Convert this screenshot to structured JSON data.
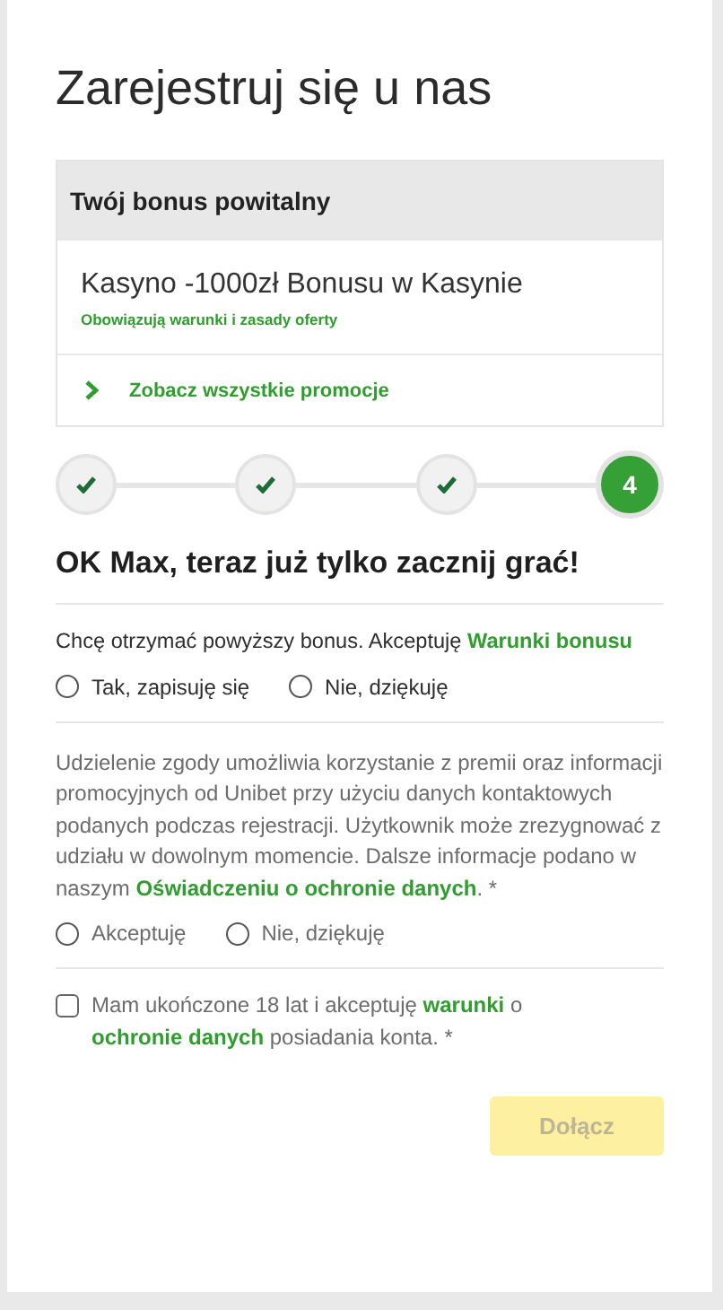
{
  "title": "Zarejestruj się u nas",
  "bonus": {
    "header": "Twój bonus powitalny",
    "name": "Kasyno -1000zł Bonusu w Kasynie",
    "terms": "Obowiązują warunki i zasady oferty",
    "link": "Zobacz wszystkie promocje"
  },
  "steps": [
    {
      "kind": "done"
    },
    {
      "kind": "done"
    },
    {
      "kind": "done"
    },
    {
      "kind": "current",
      "label": "4"
    }
  ],
  "heading": "OK Max, teraz już tylko zacznij grać!",
  "bonus_consent": {
    "text": [
      {
        "kind": "text",
        "text": "Chcę otrzymać powyższy bonus. Akceptuję "
      },
      {
        "kind": "link",
        "text": "Warunki bonusu"
      }
    ],
    "options": [
      {
        "label": "Tak, zapisuję się",
        "selected": false
      },
      {
        "label": "Nie, dziękuję",
        "selected": false
      }
    ]
  },
  "marketing_consent": {
    "text": [
      {
        "kind": "text",
        "text": "Udzielenie zgody umożliwia korzystanie z premii oraz informacji promocyjnych od Unibet przy użyciu danych kontaktowych podanych podczas rejestracji. Użytkownik może zrezygnować z udziału w dowolnym momencie. Dalsze informacje podano w naszym "
      },
      {
        "kind": "link",
        "text": "Oświadczeniu o ochronie "
      },
      {
        "kind": "link",
        "text": "danych"
      },
      {
        "kind": "text",
        "text": ". *"
      }
    ],
    "options": [
      {
        "label": "Akceptuję",
        "selected": false
      },
      {
        "label": "Nie, dziękuję",
        "selected": false
      }
    ]
  },
  "age_consent": {
    "checked": false,
    "text": [
      {
        "kind": "text",
        "text": "Mam ukończone 18 lat i akceptuję "
      },
      {
        "kind": "link",
        "text": "warunki"
      },
      {
        "kind": "text",
        "text": " o "
      },
      {
        "kind": "link",
        "text": "ochronie "
      },
      {
        "kind": "link",
        "text": "danych"
      },
      {
        "kind": "text",
        "text": " posiadania konta. *"
      }
    ]
  },
  "submit": {
    "label": "Dołącz",
    "disabled": true
  }
}
